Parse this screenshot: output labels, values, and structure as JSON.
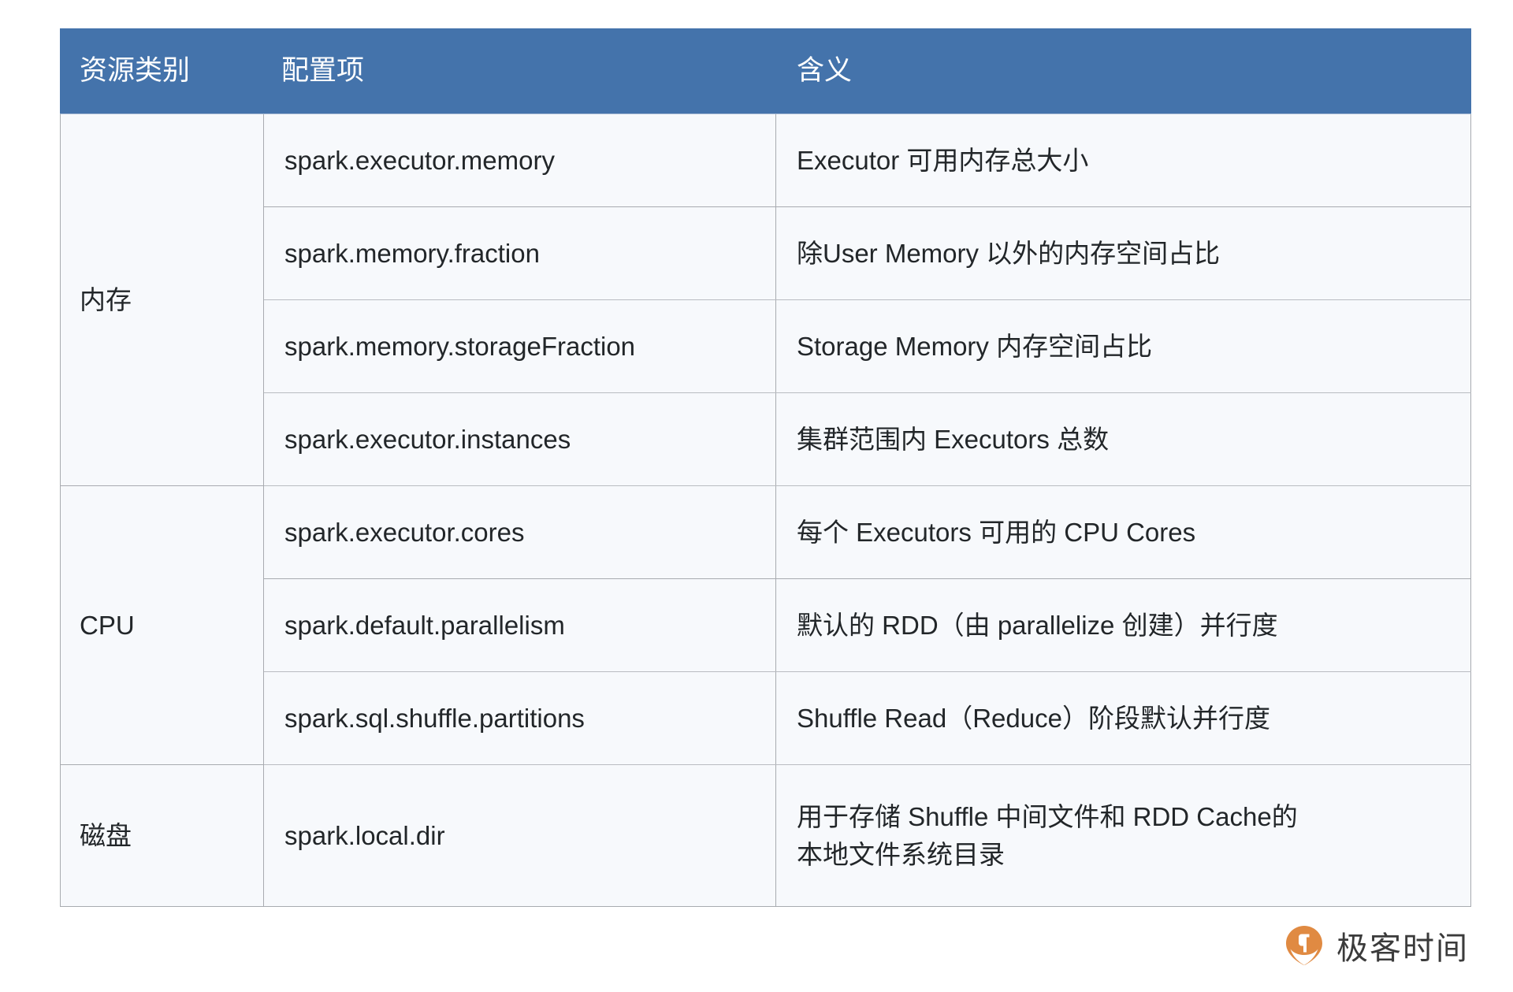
{
  "table": {
    "headers": {
      "category": "资源类别",
      "config_item": "配置项",
      "meaning": "含义"
    },
    "sections": [
      {
        "category": "内存",
        "rows": [
          {
            "config": "spark.executor.memory",
            "meaning": "Executor 可用内存总大小"
          },
          {
            "config": "spark.memory.fraction",
            "meaning": "除User Memory 以外的内存空间占比"
          },
          {
            "config": "spark.memory.storageFraction",
            "meaning": "Storage Memory 内存空间占比"
          },
          {
            "config": "spark.executor.instances",
            "meaning": "集群范围内 Executors 总数"
          }
        ]
      },
      {
        "category": "CPU",
        "rows": [
          {
            "config": "spark.executor.cores",
            "meaning": "每个 Executors 可用的 CPU Cores"
          },
          {
            "config": "spark.default.parallelism",
            "meaning": "默认的 RDD（由 parallelize  创建）并行度"
          },
          {
            "config": "spark.sql.shuffle.partitions",
            "meaning": "Shuffle Read（Reduce）阶段默认并行度"
          }
        ]
      },
      {
        "category": "磁盘",
        "rows": [
          {
            "config": "spark.local.dir",
            "meaning_line1": " 用于存储 Shuffle 中间文件和 RDD Cache的",
            "meaning_line2": "本地文件系统目录"
          }
        ]
      }
    ]
  },
  "branding": {
    "logo_text": "极客时间",
    "logo_icon": "geektime-pin-icon",
    "logo_color": "#e08a42"
  },
  "colors": {
    "header_blue": "#4473ab",
    "cell_background": "#f7f9fc",
    "border": "#a8abb0",
    "text": "#222629"
  }
}
